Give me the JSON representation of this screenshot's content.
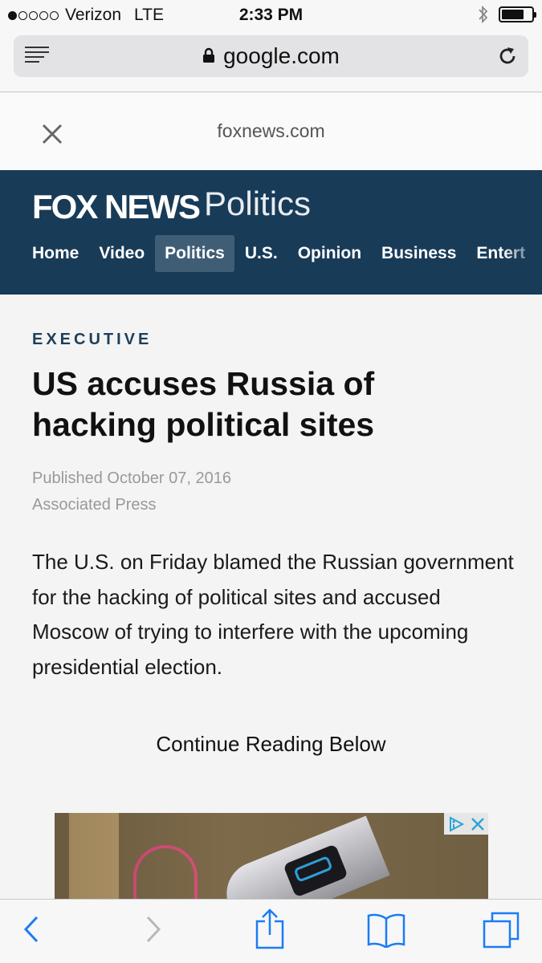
{
  "status_bar": {
    "carrier": "Verizon",
    "network": "LTE",
    "time": "2:33 PM",
    "signal_bars_filled": 1,
    "signal_bars_total": 5,
    "battery_level": 0.75
  },
  "browser": {
    "host": "google.com",
    "amp_domain": "foxnews.com"
  },
  "site": {
    "logo": "FOX NEWS",
    "section": "Politics",
    "nav": [
      {
        "label": "Home"
      },
      {
        "label": "Video"
      },
      {
        "label": "Politics",
        "active": true
      },
      {
        "label": "U.S."
      },
      {
        "label": "Opinion"
      },
      {
        "label": "Business"
      },
      {
        "label": "Entert"
      }
    ],
    "header_color": "#183b58"
  },
  "article": {
    "kicker": "EXECUTIVE",
    "headline": "US accuses Russia of hacking political sites",
    "published": "Published October 07, 2016",
    "source": "Associated Press",
    "body": "The U.S. on Friday blamed the Russian government for the hacking of political sites and accused Moscow of trying to interfere with the upcoming presidential election.",
    "continue_label": "Continue Reading Below"
  },
  "icons": {
    "reader": "reader-icon",
    "lock": "lock-icon",
    "reload": "reload-icon",
    "close": "close-icon",
    "back": "back-icon",
    "forward": "forward-icon",
    "share": "share-icon",
    "bookmarks": "bookmarks-icon",
    "tabs": "tabs-icon",
    "adchoices": "adchoices-icon"
  }
}
